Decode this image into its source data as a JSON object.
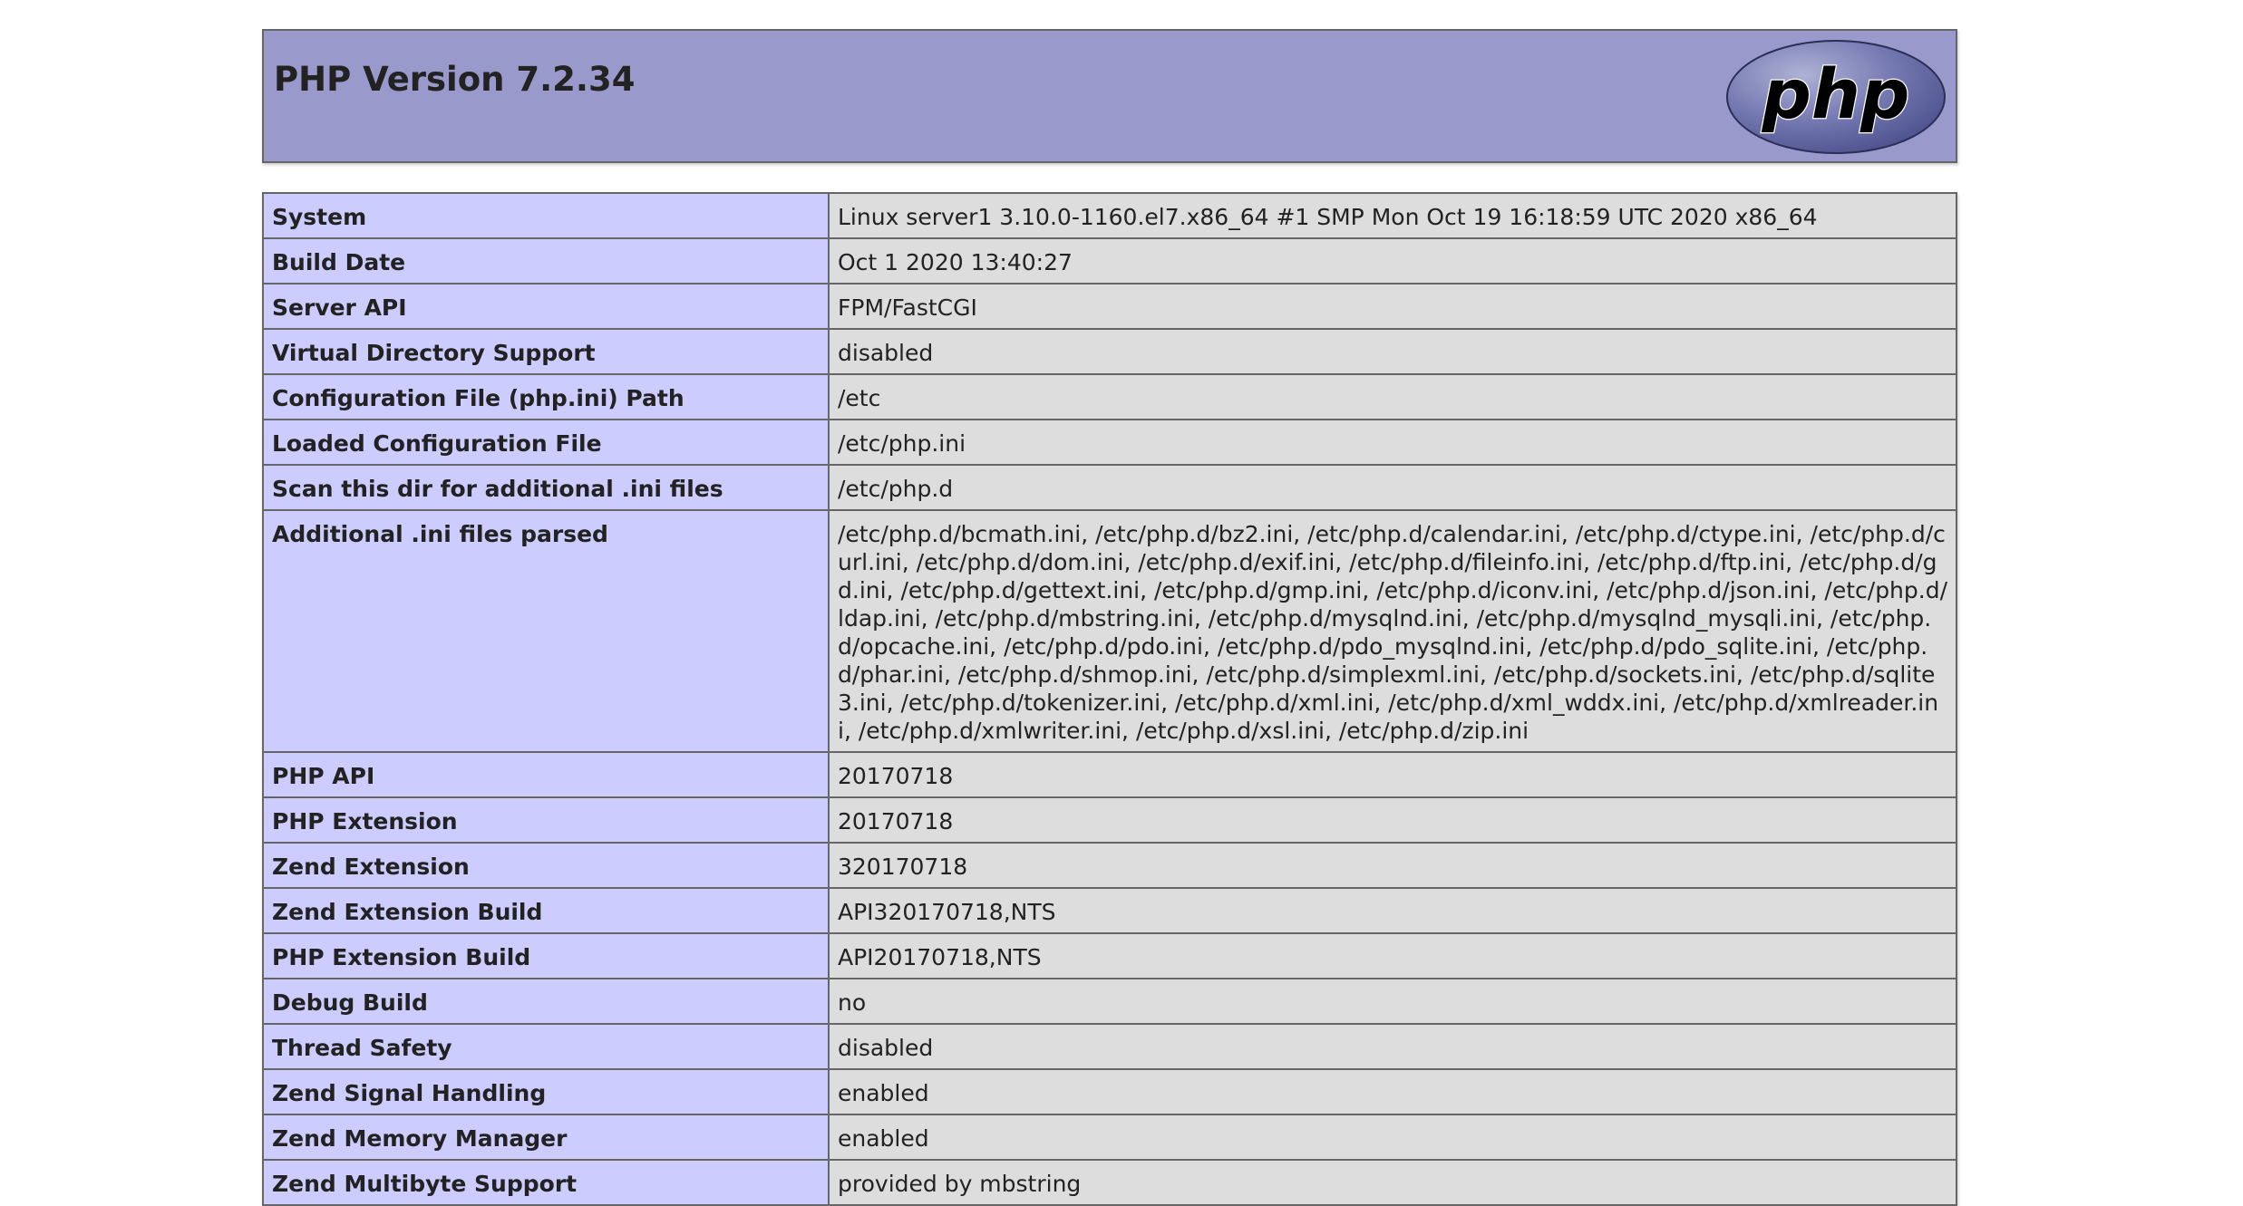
{
  "header": {
    "title": "PHP Version 7.2.34",
    "logo_text": "php"
  },
  "colors": {
    "header_bg": "#9999cc",
    "key_bg": "#ccccff",
    "value_bg": "#dddddd",
    "border": "#666666"
  },
  "rows": [
    {
      "key": "System",
      "value": "Linux server1 3.10.0-1160.el7.x86_64 #1 SMP Mon Oct 19 16:18:59 UTC 2020 x86_64"
    },
    {
      "key": "Build Date",
      "value": "Oct 1 2020 13:40:27"
    },
    {
      "key": "Server API",
      "value": "FPM/FastCGI"
    },
    {
      "key": "Virtual Directory Support",
      "value": "disabled"
    },
    {
      "key": "Configuration File (php.ini) Path",
      "value": "/etc"
    },
    {
      "key": "Loaded Configuration File",
      "value": "/etc/php.ini"
    },
    {
      "key": "Scan this dir for additional .ini files",
      "value": "/etc/php.d"
    },
    {
      "key": "Additional .ini files parsed",
      "value": "/etc/php.d/bcmath.ini, /etc/php.d/bz2.ini, /etc/php.d/calendar.ini, /etc/php.d/ctype.ini, /etc/php.d/curl.ini, /etc/php.d/dom.ini, /etc/php.d/exif.ini, /etc/php.d/fileinfo.ini, /etc/php.d/ftp.ini, /etc/php.d/gd.ini, /etc/php.d/gettext.ini, /etc/php.d/gmp.ini, /etc/php.d/iconv.ini, /etc/php.d/json.ini, /etc/php.d/ldap.ini, /etc/php.d/mbstring.ini, /etc/php.d/mysqlnd.ini, /etc/php.d/mysqlnd_mysqli.ini, /etc/php.d/opcache.ini, /etc/php.d/pdo.ini, /etc/php.d/pdo_mysqlnd.ini, /etc/php.d/pdo_sqlite.ini, /etc/php.d/phar.ini, /etc/php.d/shmop.ini, /etc/php.d/simplexml.ini, /etc/php.d/sockets.ini, /etc/php.d/sqlite3.ini, /etc/php.d/tokenizer.ini, /etc/php.d/xml.ini, /etc/php.d/xml_wddx.ini, /etc/php.d/xmlreader.ini, /etc/php.d/xmlwriter.ini, /etc/php.d/xsl.ini, /etc/php.d/zip.ini"
    },
    {
      "key": "PHP API",
      "value": "20170718"
    },
    {
      "key": "PHP Extension",
      "value": "20170718"
    },
    {
      "key": "Zend Extension",
      "value": "320170718"
    },
    {
      "key": "Zend Extension Build",
      "value": "API320170718,NTS"
    },
    {
      "key": "PHP Extension Build",
      "value": "API20170718,NTS"
    },
    {
      "key": "Debug Build",
      "value": "no"
    },
    {
      "key": "Thread Safety",
      "value": "disabled"
    },
    {
      "key": "Zend Signal Handling",
      "value": "enabled"
    },
    {
      "key": "Zend Memory Manager",
      "value": "enabled"
    },
    {
      "key": "Zend Multibyte Support",
      "value": "provided by mbstring"
    }
  ]
}
